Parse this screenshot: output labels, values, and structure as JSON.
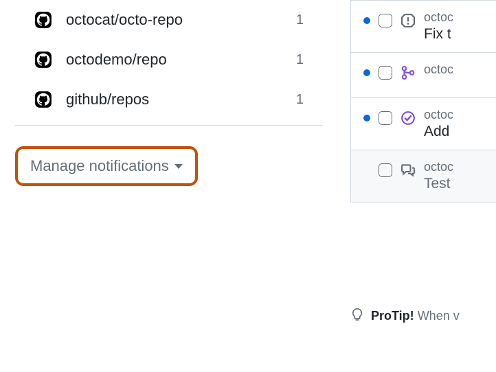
{
  "sidebar": {
    "repos": [
      {
        "name": "octocat/octo-repo",
        "count": "1"
      },
      {
        "name": "octodemo/repo",
        "count": "1"
      },
      {
        "name": "github/repos",
        "count": "1"
      }
    ],
    "manage_label": "Manage notifications"
  },
  "notifications": [
    {
      "repo": "octoc",
      "title": "Fix t",
      "icon": "issue",
      "unread": true,
      "dim": false
    },
    {
      "repo": "octoc",
      "title": "",
      "icon": "merge",
      "unread": true,
      "dim": false
    },
    {
      "repo": "octoc",
      "title": "Add",
      "icon": "check",
      "unread": true,
      "dim": false
    },
    {
      "repo": "octoc",
      "title": "Test",
      "icon": "discussion",
      "unread": false,
      "dim": true
    }
  ],
  "protip": {
    "label": "ProTip!",
    "text": "When v"
  }
}
